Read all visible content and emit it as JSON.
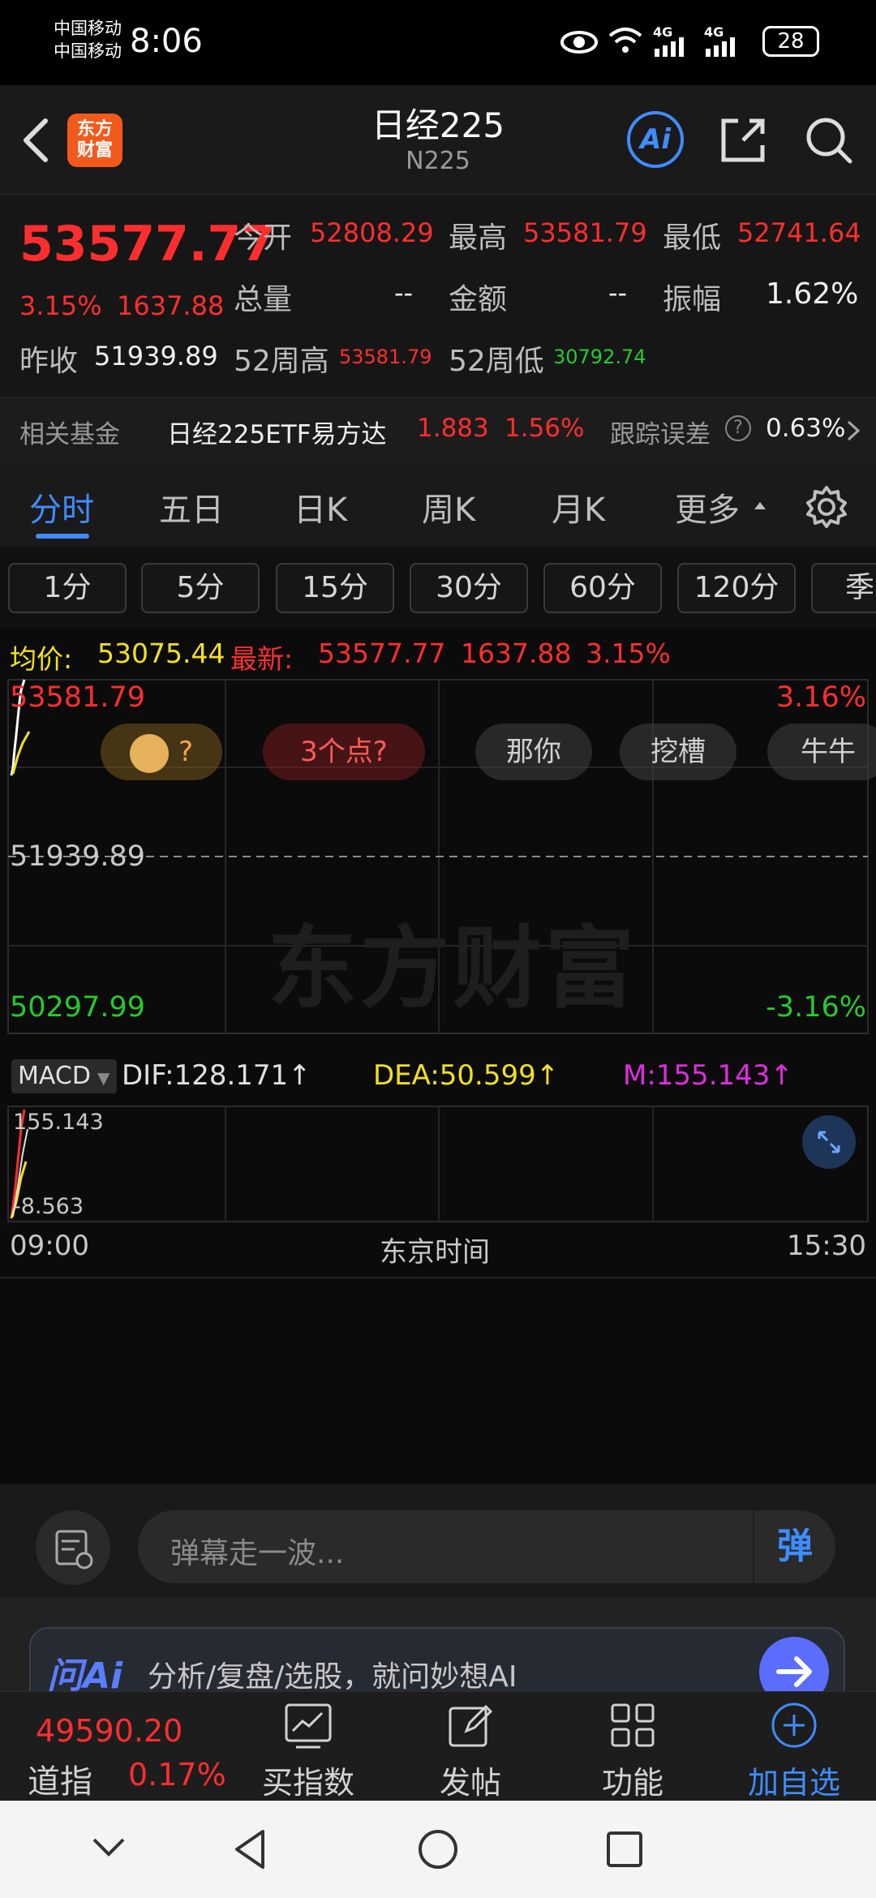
{
  "status_bar": {
    "carrier_1": "中国移动",
    "carrier_2": "中国移动",
    "time": "8:06",
    "net_1": "4G",
    "net_2": "4G",
    "battery": "28"
  },
  "header": {
    "logo_text": "东方\n财富",
    "title": "日经225",
    "subtitle": "N225",
    "ai_label": "Ai"
  },
  "quote": {
    "price": "53577.77",
    "change_pct": "3.15%",
    "change_abs": "1637.88",
    "prev_close_label": "昨收",
    "prev_close": "51939.89",
    "open_label": "今开",
    "open": "52808.29",
    "high_label": "最高",
    "high": "53581.79",
    "low_label": "最低",
    "low": "52741.64",
    "volume_label": "总量",
    "volume": "--",
    "amount_label": "金额",
    "amount": "--",
    "amplitude_label": "振幅",
    "amplitude": "1.62%",
    "w52_high_label": "52周高",
    "w52_high": "53581.79",
    "w52_low_label": "52周低",
    "w52_low": "30792.74"
  },
  "fund_row": {
    "label": "相关基金",
    "fund_name": "日经225ETF易方达",
    "fund_price": "1.883",
    "fund_pct": "1.56%",
    "tracking_label": "跟踪误差",
    "tracking_value": "0.63%"
  },
  "tabs": {
    "items": [
      "分时",
      "五日",
      "日K",
      "周K",
      "月K",
      "更多"
    ],
    "active": "分时"
  },
  "chips": [
    "1分",
    "5分",
    "15分",
    "30分",
    "60分",
    "120分",
    "季"
  ],
  "chart": {
    "avg_label": "均价:",
    "avg_value": "53075.44",
    "latest_label": "最新:",
    "latest_value": "53577.77",
    "latest_abs": "1637.88",
    "latest_pct": "3.15%",
    "y_top": "53581.79",
    "y_mid": "51939.89",
    "y_bottom": "50297.99",
    "pct_top": "3.16%",
    "pct_bottom": "-3.16%",
    "watermark": "东方财富",
    "bubbles": [
      "?",
      "3个点?",
      "那你",
      "挖槽",
      "牛牛"
    ],
    "time_start": "09:00",
    "time_zone_label": "东京时间",
    "time_end": "15:30",
    "line_color": "#ffffff",
    "avg_color": "#f2e11d"
  },
  "macd": {
    "selector": "MACD",
    "dif": "DIF:128.171↑",
    "dea": "DEA:50.599↑",
    "m": "M:155.143↑",
    "top_value": "155.143",
    "bottom_value": "-8.563",
    "dif_color": "#e0e0e0",
    "dea_color": "#f2e11d",
    "m_color": "#e02ce0"
  },
  "barrage": {
    "placeholder": "弹幕走一波...",
    "send_label": "弹"
  },
  "ask_ai": {
    "brand": "问Ai",
    "text": "分析/复盘/选股，就问妙想AI"
  },
  "bottom_nav": {
    "index_value": "49590.20",
    "index_name": "道指",
    "index_pct": "0.17%",
    "items": [
      "买指数",
      "发帖",
      "功能",
      "加自选"
    ]
  }
}
